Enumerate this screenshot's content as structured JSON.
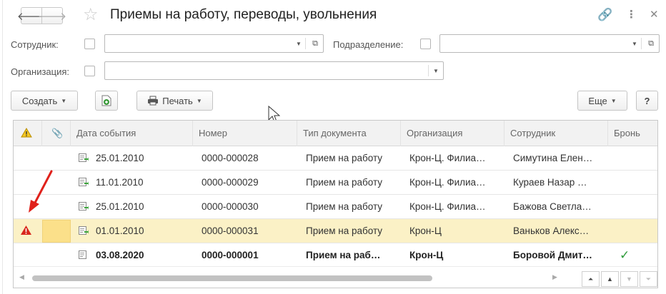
{
  "window": {
    "title": "Приемы на работу, переводы, увольнения",
    "back_icon": "arrow-left-icon",
    "forward_icon": "arrow-right-icon",
    "favorite_icon": "star-icon",
    "link_icon": "link-icon",
    "menu_icon": "kebab-menu-icon",
    "close_icon": "close-icon"
  },
  "filters": {
    "employee": {
      "label": "Сотрудник:",
      "value": ""
    },
    "department": {
      "label": "Подразделение:",
      "value": ""
    },
    "organization": {
      "label": "Организация:",
      "value": ""
    }
  },
  "toolbar": {
    "create_label": "Создать",
    "print_label": "Печать",
    "more_label": "Еще",
    "help_label": "?"
  },
  "grid": {
    "columns": [
      "",
      "",
      "Дата события",
      "Номер",
      "Тип документа",
      "Организация",
      "Сотрудник",
      "Бронь"
    ],
    "rows": [
      {
        "date": "25.01.2010",
        "number": "0000-000028",
        "type": "Прием на работу",
        "org": "Крон-Ц. Филиа…",
        "employee": "Симутина Елен…",
        "reserve": "",
        "warning": false,
        "selected": false,
        "bold": false
      },
      {
        "date": "11.01.2010",
        "number": "0000-000029",
        "type": "Прием на работу",
        "org": "Крон-Ц. Филиа…",
        "employee": "Кураев Назар …",
        "reserve": "",
        "warning": false,
        "selected": false,
        "bold": false
      },
      {
        "date": "25.01.2010",
        "number": "0000-000030",
        "type": "Прием на работу",
        "org": "Крон-Ц. Филиа…",
        "employee": "Бажова Светла…",
        "reserve": "",
        "warning": false,
        "selected": false,
        "bold": false
      },
      {
        "date": "01.01.2010",
        "number": "0000-000031",
        "type": "Прием на работу",
        "org": "Крон-Ц",
        "employee": "Ваньков Алекс…",
        "reserve": "",
        "warning": true,
        "selected": true,
        "bold": false
      },
      {
        "date": "03.08.2020",
        "number": "0000-000001",
        "type": "Прием на раб…",
        "org": "Крон-Ц",
        "employee": "Боровой Дмит…",
        "reserve": "✓",
        "warning": false,
        "selected": false,
        "bold": true
      }
    ]
  },
  "colors": {
    "warning": "#d9261c",
    "selected_row": "#fbf1c6",
    "check": "#2e9b3a",
    "annotation_arrow": "#e0211b"
  }
}
